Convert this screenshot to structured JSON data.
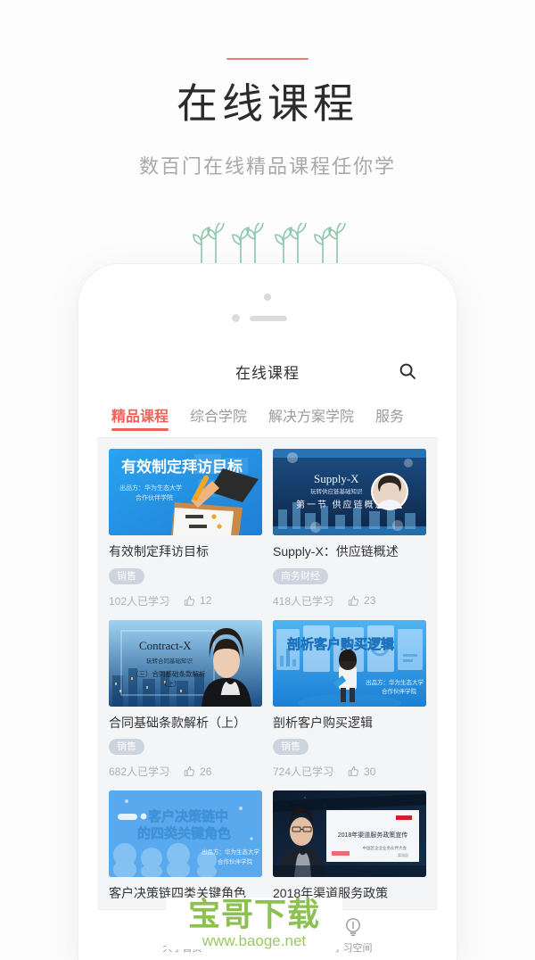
{
  "promo": {
    "title": "在线课程",
    "subtitle": "数百门在线精品课程任你学",
    "rule_color": "#ef7b75"
  },
  "app": {
    "title": "在线课程",
    "search_icon": "search-icon",
    "accent_color": "#f0615a",
    "tabs": [
      {
        "label": "精品课程",
        "active": true
      },
      {
        "label": "综合学院",
        "active": false
      },
      {
        "label": "解决方案学院",
        "active": false
      },
      {
        "label": "服务",
        "active": false
      }
    ]
  },
  "courses": [
    {
      "title": "有效制定拜访目标",
      "tag": "销售",
      "learners": "102人已学习",
      "likes": "12",
      "thumb": {
        "style": "blue-illustration",
        "headline": "有效制定拜访目标",
        "producer_line1": "出品方：华为生态大学",
        "producer_line2": "合作伙伴学院"
      }
    },
    {
      "title": "Supply-X：供应链概述",
      "tag": "商务财经",
      "learners": "418人已学习",
      "likes": "23",
      "thumb": {
        "style": "dark-city-avatar",
        "headline": "Supply-X",
        "sub1": "玩转供应链基础知识",
        "sub2": "第一节 供应链概述"
      }
    },
    {
      "title": "合同基础条款解析（上）",
      "tag": "销售",
      "learners": "682人已学习",
      "likes": "26",
      "thumb": {
        "style": "contract-woman",
        "headline": "Contract-X",
        "sub1": "玩转合同基础知识",
        "sub2": "（三）合同基础条款解析",
        "sub3": "（上）"
      }
    },
    {
      "title": "剖析客户购买逻辑",
      "tag": "销售",
      "learners": "724人已学习",
      "likes": "30",
      "thumb": {
        "style": "blue-screens-person",
        "headline": "剖析客户购买逻辑",
        "producer_line1": "出品方：华为生态大学",
        "producer_line2": "合作伙伴学院"
      }
    },
    {
      "title": "客户决策链四类关键角色",
      "tag": "",
      "learners": "",
      "likes": "",
      "thumb": {
        "style": "blue-silhouettes",
        "headline1": "客户决策链中",
        "headline2": "的四类关键角色",
        "producer_line1": "出品方：华为生态大学",
        "producer_line2": "合作伙伴学院"
      }
    },
    {
      "title": "2018年渠道服务政策",
      "tag": "",
      "learners": "",
      "likes": "",
      "thumb": {
        "style": "presenter-slide",
        "headline": "2018年渠道服务政策宣传",
        "sub1": "中国区企业业务伙伴大会",
        "sub2": "渠道部"
      }
    }
  ],
  "tabbar": [
    {
      "label": "大学首页",
      "icon": "home-icon"
    },
    {
      "label": "学习空间",
      "icon": "lightbulb-icon"
    }
  ],
  "watermark": {
    "brand": "宝哥下载",
    "url": "www.baoge.net",
    "color": "#8cc152"
  }
}
